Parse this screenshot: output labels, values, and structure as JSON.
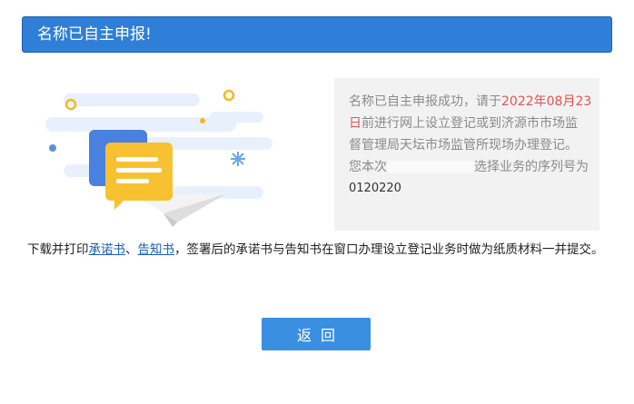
{
  "header": {
    "title": "名称已自主申报!"
  },
  "info": {
    "line1_prefix": "名称已自主申报成功，请于",
    "date_part1": "2022年08月23",
    "date_part2": "日",
    "line2_suffix": "前进行网上设立登记或到济源市市场监",
    "line3": "督管理局天坛市场监管所现场办理登记。",
    "line4_prefix": "您本次",
    "line4_suffix": "选择业务的序列号为",
    "serial": "0120220"
  },
  "notice": {
    "prefix": "下载并打印",
    "link_commitment": "承诺书",
    "separator": "、",
    "link_notification": "告知书",
    "suffix": "，签署后的承诺书与告知书在窗口办理设立登记业务时做为纸质材料一并提交。"
  },
  "actions": {
    "back_label": "返回"
  },
  "colors": {
    "header_bg": "#2f7fd8",
    "highlight_date": "#e55353",
    "link": "#1a5fb4",
    "button_bg": "#3a8fe0"
  },
  "icons": {
    "illustration": "message-plane-illustration"
  }
}
